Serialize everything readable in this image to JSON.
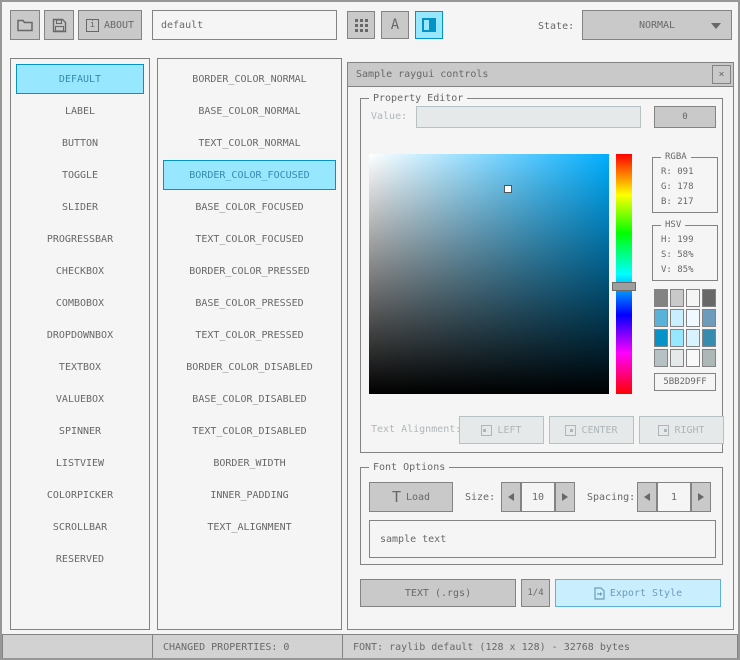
{
  "toolbar": {
    "about_icon_glyph": "i",
    "about_label": "ABOUT",
    "style_name": "default",
    "font_button_glyph": "A",
    "state_label": "State:",
    "state_value": "NORMAL"
  },
  "controls": {
    "selected": "DEFAULT",
    "items": [
      "DEFAULT",
      "LABEL",
      "BUTTON",
      "TOGGLE",
      "SLIDER",
      "PROGRESSBAR",
      "CHECKBOX",
      "COMBOBOX",
      "DROPDOWNBOX",
      "TEXTBOX",
      "VALUEBOX",
      "SPINNER",
      "LISTVIEW",
      "COLORPICKER",
      "SCROLLBAR",
      "RESERVED"
    ]
  },
  "properties": {
    "selected": "BORDER_COLOR_FOCUSED",
    "items": [
      "BORDER_COLOR_NORMAL",
      "BASE_COLOR_NORMAL",
      "TEXT_COLOR_NORMAL",
      "BORDER_COLOR_FOCUSED",
      "BASE_COLOR_FOCUSED",
      "TEXT_COLOR_FOCUSED",
      "BORDER_COLOR_PRESSED",
      "BASE_COLOR_PRESSED",
      "TEXT_COLOR_PRESSED",
      "BORDER_COLOR_DISABLED",
      "BASE_COLOR_DISABLED",
      "TEXT_COLOR_DISABLED",
      "BORDER_WIDTH",
      "INNER_PADDING",
      "TEXT_ALIGNMENT"
    ]
  },
  "sample_window": {
    "title": "Sample raygui controls",
    "close_glyph": "×"
  },
  "property_editor": {
    "label": "Property Editor",
    "value_label": "Value:",
    "value_text": "",
    "value_button_label": "0",
    "rgba_label": "RGBA",
    "rgba_r": "R: 091",
    "rgba_g": "G: 178",
    "rgba_b": "B: 217",
    "hsv_label": "HSV",
    "hsv_h": "H: 199",
    "hsv_s": "S: 58%",
    "hsv_v": "V: 85%",
    "hex_value": "5BB2D9FF",
    "palette": [
      "#838383",
      "#c9c9c9",
      "#f5f5f5",
      "#686868",
      "#5bb2d9",
      "#c9effe",
      "#eff9ff",
      "#6c9bbc",
      "#0492c7",
      "#97e8ff",
      "#d8f3fe",
      "#368bae",
      "#b5c1c2",
      "#e6e9e9",
      "#f8f8f8",
      "#aeb7b8"
    ],
    "alignment_label": "Text Alignment:",
    "align_left": "LEFT",
    "align_center": "CENTER",
    "align_right": "RIGHT"
  },
  "font_options": {
    "label": "Font Options",
    "load_icon_glyph": "T",
    "load_label": "Load",
    "size_label": "Size:",
    "size_value": "10",
    "spacing_label": "Spacing:",
    "spacing_value": "1",
    "sample_text": "sample text"
  },
  "export_bar": {
    "format_button": "TEXT (.rgs)",
    "page_indicator": "1/4",
    "export_button": "Export Style"
  },
  "statusbar": {
    "left": "",
    "changed": "CHANGED PROPERTIES: 0",
    "font_info": "FONT: raylib default (128 x 128) - 32768 bytes"
  },
  "picker": {
    "hue_deg": 199,
    "saturation_pct": 58,
    "value_pct": 85,
    "selected_color_hex": "#5BB2D9"
  }
}
